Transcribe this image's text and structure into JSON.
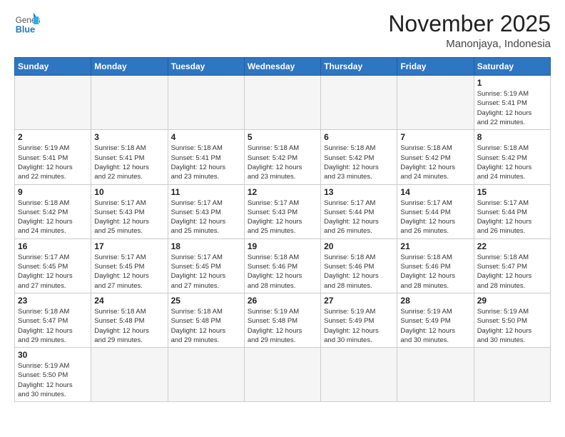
{
  "logo": {
    "line1": "General",
    "line2": "Blue"
  },
  "header": {
    "month_year": "November 2025",
    "location": "Manonjaya, Indonesia"
  },
  "weekdays": [
    "Sunday",
    "Monday",
    "Tuesday",
    "Wednesday",
    "Thursday",
    "Friday",
    "Saturday"
  ],
  "weeks": [
    [
      {
        "day": "",
        "info": ""
      },
      {
        "day": "",
        "info": ""
      },
      {
        "day": "",
        "info": ""
      },
      {
        "day": "",
        "info": ""
      },
      {
        "day": "",
        "info": ""
      },
      {
        "day": "",
        "info": ""
      },
      {
        "day": "1",
        "info": "Sunrise: 5:19 AM\nSunset: 5:41 PM\nDaylight: 12 hours\nand 22 minutes."
      }
    ],
    [
      {
        "day": "2",
        "info": "Sunrise: 5:19 AM\nSunset: 5:41 PM\nDaylight: 12 hours\nand 22 minutes."
      },
      {
        "day": "3",
        "info": "Sunrise: 5:18 AM\nSunset: 5:41 PM\nDaylight: 12 hours\nand 22 minutes."
      },
      {
        "day": "4",
        "info": "Sunrise: 5:18 AM\nSunset: 5:41 PM\nDaylight: 12 hours\nand 23 minutes."
      },
      {
        "day": "5",
        "info": "Sunrise: 5:18 AM\nSunset: 5:42 PM\nDaylight: 12 hours\nand 23 minutes."
      },
      {
        "day": "6",
        "info": "Sunrise: 5:18 AM\nSunset: 5:42 PM\nDaylight: 12 hours\nand 23 minutes."
      },
      {
        "day": "7",
        "info": "Sunrise: 5:18 AM\nSunset: 5:42 PM\nDaylight: 12 hours\nand 24 minutes."
      },
      {
        "day": "8",
        "info": "Sunrise: 5:18 AM\nSunset: 5:42 PM\nDaylight: 12 hours\nand 24 minutes."
      }
    ],
    [
      {
        "day": "9",
        "info": "Sunrise: 5:18 AM\nSunset: 5:42 PM\nDaylight: 12 hours\nand 24 minutes."
      },
      {
        "day": "10",
        "info": "Sunrise: 5:17 AM\nSunset: 5:43 PM\nDaylight: 12 hours\nand 25 minutes."
      },
      {
        "day": "11",
        "info": "Sunrise: 5:17 AM\nSunset: 5:43 PM\nDaylight: 12 hours\nand 25 minutes."
      },
      {
        "day": "12",
        "info": "Sunrise: 5:17 AM\nSunset: 5:43 PM\nDaylight: 12 hours\nand 25 minutes."
      },
      {
        "day": "13",
        "info": "Sunrise: 5:17 AM\nSunset: 5:44 PM\nDaylight: 12 hours\nand 26 minutes."
      },
      {
        "day": "14",
        "info": "Sunrise: 5:17 AM\nSunset: 5:44 PM\nDaylight: 12 hours\nand 26 minutes."
      },
      {
        "day": "15",
        "info": "Sunrise: 5:17 AM\nSunset: 5:44 PM\nDaylight: 12 hours\nand 26 minutes."
      }
    ],
    [
      {
        "day": "16",
        "info": "Sunrise: 5:17 AM\nSunset: 5:45 PM\nDaylight: 12 hours\nand 27 minutes."
      },
      {
        "day": "17",
        "info": "Sunrise: 5:17 AM\nSunset: 5:45 PM\nDaylight: 12 hours\nand 27 minutes."
      },
      {
        "day": "18",
        "info": "Sunrise: 5:17 AM\nSunset: 5:45 PM\nDaylight: 12 hours\nand 27 minutes."
      },
      {
        "day": "19",
        "info": "Sunrise: 5:18 AM\nSunset: 5:46 PM\nDaylight: 12 hours\nand 28 minutes."
      },
      {
        "day": "20",
        "info": "Sunrise: 5:18 AM\nSunset: 5:46 PM\nDaylight: 12 hours\nand 28 minutes."
      },
      {
        "day": "21",
        "info": "Sunrise: 5:18 AM\nSunset: 5:46 PM\nDaylight: 12 hours\nand 28 minutes."
      },
      {
        "day": "22",
        "info": "Sunrise: 5:18 AM\nSunset: 5:47 PM\nDaylight: 12 hours\nand 28 minutes."
      }
    ],
    [
      {
        "day": "23",
        "info": "Sunrise: 5:18 AM\nSunset: 5:47 PM\nDaylight: 12 hours\nand 29 minutes."
      },
      {
        "day": "24",
        "info": "Sunrise: 5:18 AM\nSunset: 5:48 PM\nDaylight: 12 hours\nand 29 minutes."
      },
      {
        "day": "25",
        "info": "Sunrise: 5:18 AM\nSunset: 5:48 PM\nDaylight: 12 hours\nand 29 minutes."
      },
      {
        "day": "26",
        "info": "Sunrise: 5:19 AM\nSunset: 5:48 PM\nDaylight: 12 hours\nand 29 minutes."
      },
      {
        "day": "27",
        "info": "Sunrise: 5:19 AM\nSunset: 5:49 PM\nDaylight: 12 hours\nand 30 minutes."
      },
      {
        "day": "28",
        "info": "Sunrise: 5:19 AM\nSunset: 5:49 PM\nDaylight: 12 hours\nand 30 minutes."
      },
      {
        "day": "29",
        "info": "Sunrise: 5:19 AM\nSunset: 5:50 PM\nDaylight: 12 hours\nand 30 minutes."
      }
    ],
    [
      {
        "day": "30",
        "info": "Sunrise: 5:19 AM\nSunset: 5:50 PM\nDaylight: 12 hours\nand 30 minutes."
      },
      {
        "day": "",
        "info": ""
      },
      {
        "day": "",
        "info": ""
      },
      {
        "day": "",
        "info": ""
      },
      {
        "day": "",
        "info": ""
      },
      {
        "day": "",
        "info": ""
      },
      {
        "day": "",
        "info": ""
      }
    ]
  ]
}
